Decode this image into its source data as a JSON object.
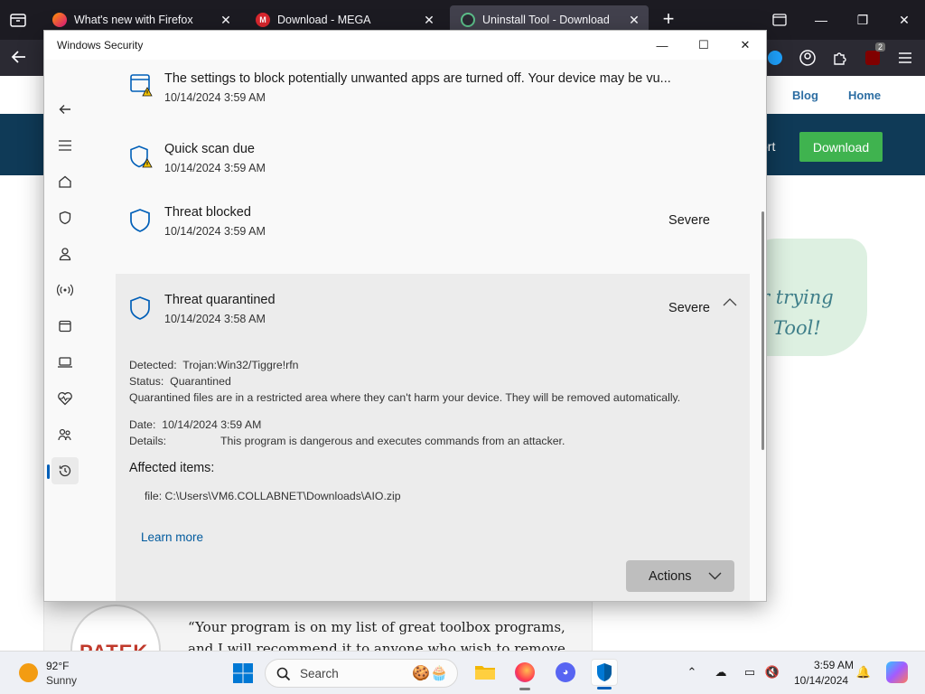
{
  "browser": {
    "tabs": [
      {
        "title": "What's new with Firefox",
        "favicon": "firefox-icon",
        "active": false
      },
      {
        "title": "Download - MEGA",
        "favicon": "mega-icon",
        "active": false
      },
      {
        "title": "Uninstall Tool - Download",
        "favicon": "uninstall-tool-icon",
        "active": true
      }
    ],
    "extension_badge": "2"
  },
  "website": {
    "nav_links": [
      "Blog",
      "Home"
    ],
    "banner_link_fragment": "ort",
    "download_label": "Download",
    "promo_line1": "r trying",
    "promo_line2": "Tool!",
    "logo_text": "PATEK",
    "quote": "“Your program is on my list of great toolbox programs, and I will recommend it to anyone who wish to remove"
  },
  "security_window": {
    "title": "Windows Security",
    "items": [
      {
        "title": "The settings to block potentially unwanted apps are turned off. Your device may be vu...",
        "date": "10/14/2024 3:59 AM",
        "icon": "shield-warning-app-icon",
        "severity": ""
      },
      {
        "title": "Quick scan due",
        "date": "10/14/2024 3:59 AM",
        "icon": "shield-warning-icon",
        "severity": ""
      },
      {
        "title": "Threat blocked",
        "date": "10/14/2024 3:59 AM",
        "icon": "shield-icon",
        "severity": "Severe"
      },
      {
        "title": "Threat quarantined",
        "date": "10/14/2024 3:58 AM",
        "icon": "shield-icon",
        "severity": "Severe"
      }
    ],
    "details": {
      "detected_label": "Detected:",
      "detected_value": "Trojan:Win32/Tiggre!rfn",
      "status_label": "Status:",
      "status_value": "Quarantined",
      "status_note": "Quarantined files are in a restricted area where they can't harm your device. They will be removed automatically.",
      "date_label": "Date:",
      "date_value": "10/14/2024 3:59 AM",
      "details_label": "Details:",
      "details_value": "This program is dangerous and executes commands from an attacker.",
      "affected_heading": "Affected items:",
      "affected_item": "file: C:\\Users\\VM6.COLLABNET\\Downloads\\AIO.zip",
      "learn_more": "Learn more",
      "actions": "Actions"
    },
    "accent_color": "#005fb8"
  },
  "taskbar": {
    "weather_temp": "92°F",
    "weather_desc": "Sunny",
    "search_label": "Search",
    "time": "3:59 AM",
    "date": "10/14/2024"
  }
}
